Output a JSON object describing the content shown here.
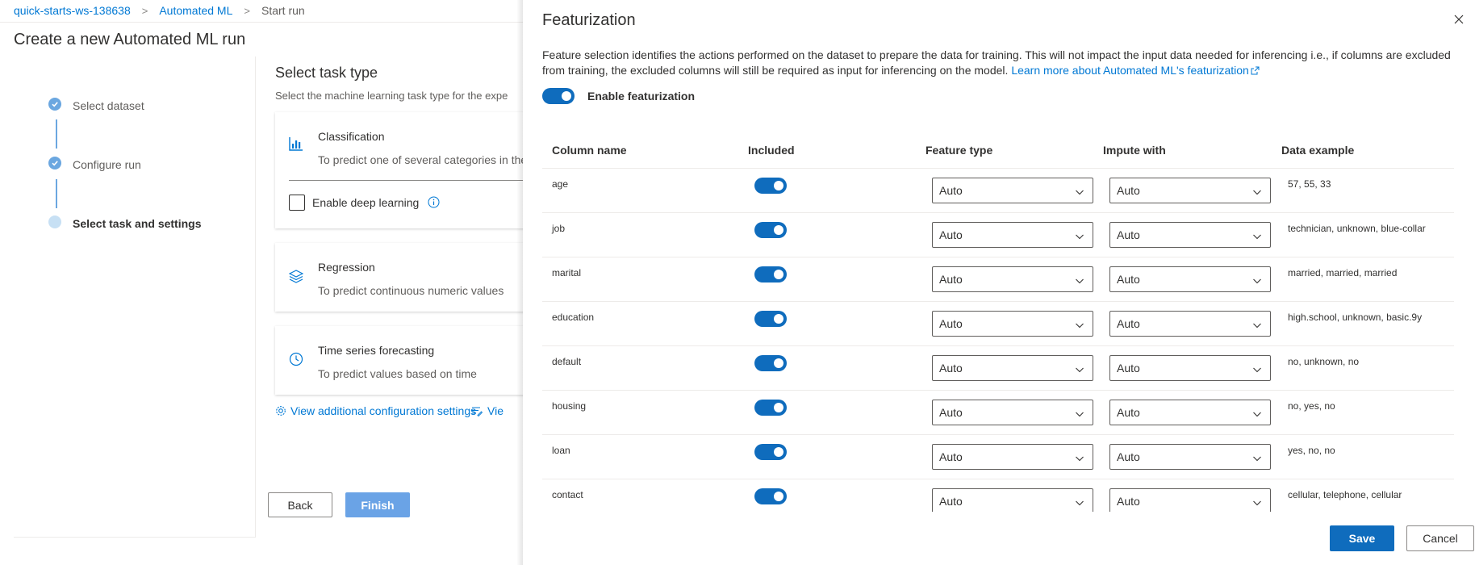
{
  "breadcrumb": {
    "workspace": "quick-starts-ws-138638",
    "section": "Automated ML",
    "current": "Start run",
    "separator": ">"
  },
  "page": {
    "title": "Create a new Automated ML run"
  },
  "steps": [
    {
      "label": "Select dataset",
      "state": "done"
    },
    {
      "label": "Configure run",
      "state": "done"
    },
    {
      "label": "Select task and settings",
      "state": "current"
    }
  ],
  "task_section": {
    "title": "Select task type",
    "description": "Select the machine learning task type for the expe"
  },
  "tasks": [
    {
      "title": "Classification",
      "description": "To predict one of several categories in the",
      "icon": "bar-chart-icon"
    },
    {
      "title": "Regression",
      "description": "To predict continuous numeric values",
      "icon": "layers-icon"
    },
    {
      "title": "Time series forecasting",
      "description": "To predict values based on time",
      "icon": "clock-icon"
    }
  ],
  "deep_learning": {
    "label": "Enable deep learning",
    "checked": false
  },
  "config_links": {
    "additional": "View additional configuration settings",
    "featurization": "Vie"
  },
  "buttons": {
    "back": "Back",
    "finish": "Finish",
    "save": "Save",
    "cancel": "Cancel"
  },
  "panel": {
    "title": "Featurization",
    "description": "Feature selection identifies the actions performed on the dataset to prepare the data for training. This will not impact the input data needed for inferencing i.e., if columns are excluded from training, the excluded columns will still be required as input for inferencing on the model.",
    "learn_more": "Learn more about Automated ML's featurization",
    "enable_label": "Enable featurization",
    "enabled": true
  },
  "table": {
    "headers": {
      "column_name": "Column name",
      "included": "Included",
      "feature_type": "Feature type",
      "impute_with": "Impute with",
      "data_example": "Data example"
    },
    "rows": [
      {
        "name": "age",
        "included": true,
        "feature_type": "Auto",
        "impute_with": "Auto",
        "example": "57, 55, 33"
      },
      {
        "name": "job",
        "included": true,
        "feature_type": "Auto",
        "impute_with": "Auto",
        "example": "technician, unknown, blue-collar"
      },
      {
        "name": "marital",
        "included": true,
        "feature_type": "Auto",
        "impute_with": "Auto",
        "example": "married, married, married"
      },
      {
        "name": "education",
        "included": true,
        "feature_type": "Auto",
        "impute_with": "Auto",
        "example": "high.school, unknown, basic.9y"
      },
      {
        "name": "default",
        "included": true,
        "feature_type": "Auto",
        "impute_with": "Auto",
        "example": "no, unknown, no"
      },
      {
        "name": "housing",
        "included": true,
        "feature_type": "Auto",
        "impute_with": "Auto",
        "example": "no, yes, no"
      },
      {
        "name": "loan",
        "included": true,
        "feature_type": "Auto",
        "impute_with": "Auto",
        "example": "yes, no, no"
      },
      {
        "name": "contact",
        "included": true,
        "feature_type": "Auto",
        "impute_with": "Auto",
        "example": "cellular, telephone, cellular"
      }
    ]
  },
  "colors": {
    "accent": "#0f6cbd",
    "link": "#0078d4",
    "finish_disabled": "#6aa3e6"
  }
}
